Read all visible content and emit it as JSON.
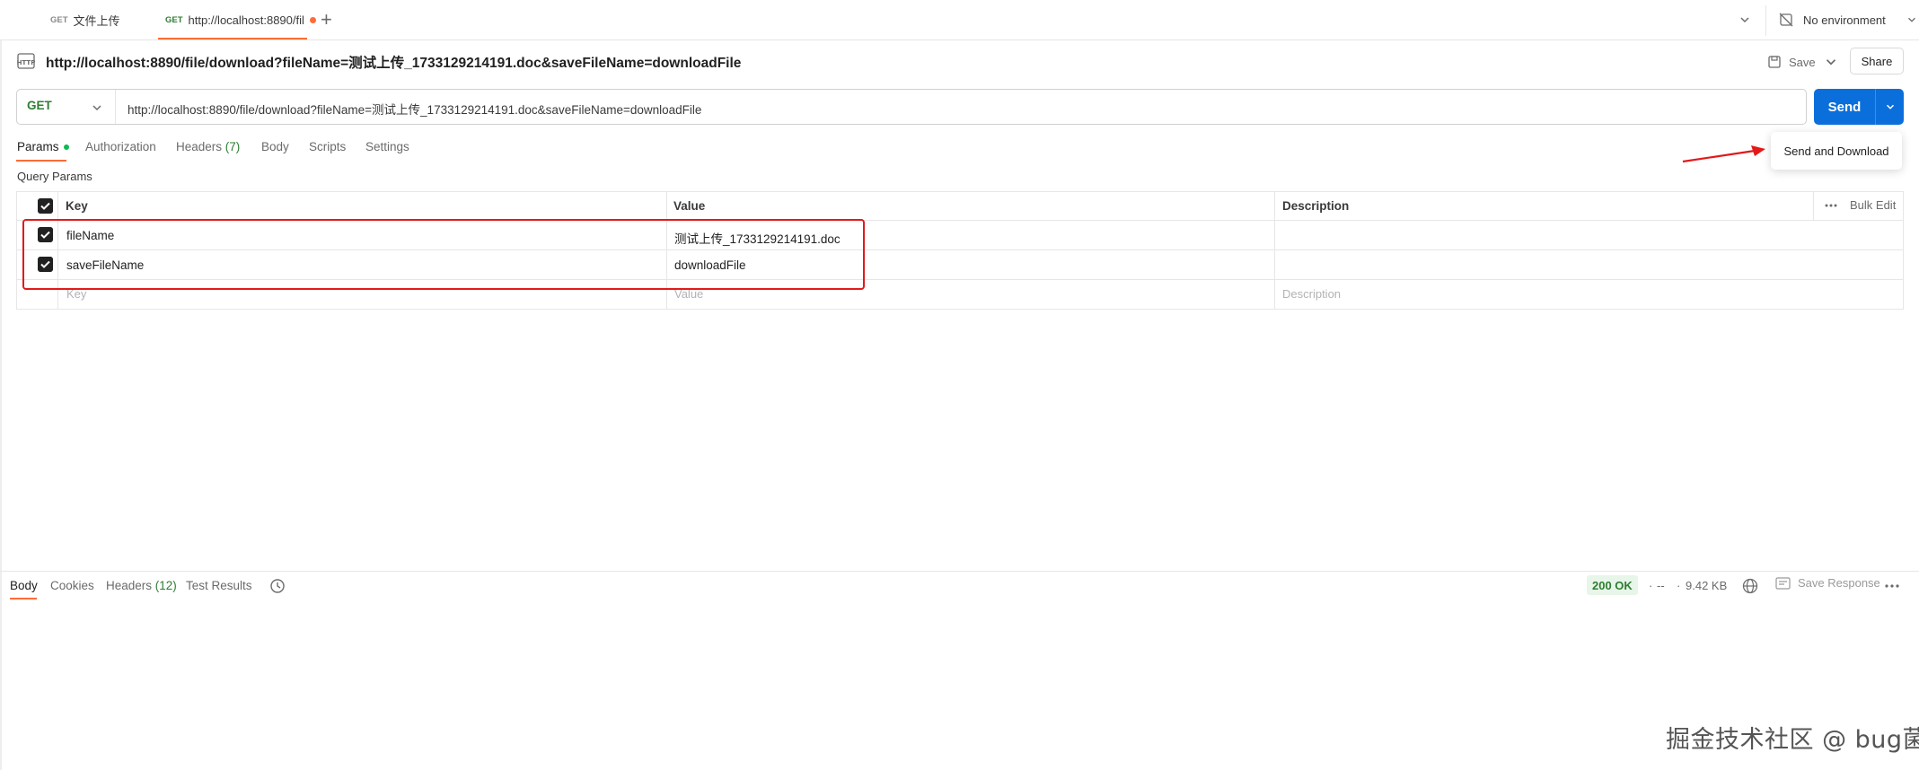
{
  "tabs": [
    {
      "method": "GET",
      "label": "文件上传",
      "active": false
    },
    {
      "method": "GET",
      "label": "http://localhost:8890/fil",
      "active": true,
      "unsaved": true
    }
  ],
  "environment": {
    "label": "No environment"
  },
  "request": {
    "title": "http://localhost:8890/file/download?fileName=测试上传_1733129214191.doc&saveFileName=downloadFile",
    "method": "GET",
    "url": "http://localhost:8890/file/download?fileName=测试上传_1733129214191.doc&saveFileName=downloadFile"
  },
  "toolbar": {
    "save_label": "Save",
    "share_label": "Share"
  },
  "send": {
    "label": "Send",
    "dropdown_item": "Send and Download"
  },
  "request_tabs": [
    {
      "label": "Params",
      "count": "",
      "active": true,
      "indicator": true
    },
    {
      "label": "Authorization",
      "count": "",
      "active": false
    },
    {
      "label": "Headers",
      "count": "(7)",
      "active": false
    },
    {
      "label": "Body",
      "count": "",
      "active": false
    },
    {
      "label": "Scripts",
      "count": "",
      "active": false
    },
    {
      "label": "Settings",
      "count": "",
      "active": false
    }
  ],
  "query_params": {
    "title": "Query Params",
    "columns": {
      "key": "Key",
      "value": "Value",
      "description": "Description"
    },
    "bulk_edit": "Bulk Edit",
    "rows": [
      {
        "checked": true,
        "key": "fileName",
        "value": "测试上传_1733129214191.doc",
        "description": ""
      },
      {
        "checked": true,
        "key": "saveFileName",
        "value": "downloadFile",
        "description": ""
      }
    ],
    "placeholder": {
      "key": "Key",
      "value": "Value",
      "description": "Description"
    }
  },
  "response": {
    "tabs": [
      {
        "label": "Body",
        "count": "",
        "active": true
      },
      {
        "label": "Cookies",
        "count": "",
        "active": false
      },
      {
        "label": "Headers",
        "count": "(12)",
        "active": false
      },
      {
        "label": "Test Results",
        "count": "",
        "active": false
      }
    ],
    "status": "200 OK",
    "time": "--",
    "size": "9.42 KB",
    "save_label": "Save Response"
  },
  "watermark": "掘金技术社区 @ bug菌",
  "colors": {
    "accent": "#ff6c37",
    "send": "#0b6fdb",
    "method_get": "#2e7d32",
    "annotation": "#e21a1a"
  },
  "icons": [
    "request-http-icon",
    "no-environment-icon",
    "save-icon",
    "chevron-down-icon",
    "history-icon",
    "globe-icon",
    "save-response-icon",
    "more-icon",
    "plus-icon",
    "checkbox-checked-icon"
  ]
}
